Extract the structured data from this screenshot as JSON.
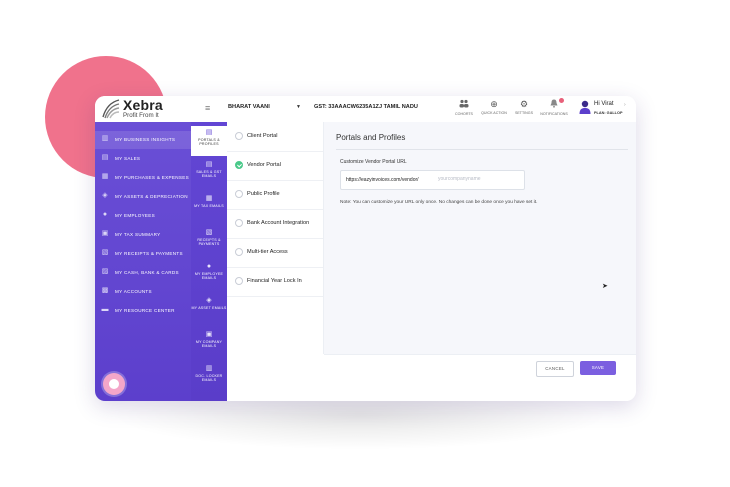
{
  "app": {
    "logo_name": "Xebra",
    "logo_tagline": "Profit From It",
    "company": "BHARAT VAANI",
    "gst": "GST: 33AAACW6235A1ZJ TAMIL NADU"
  },
  "topbar": {
    "icons": [
      {
        "label": "COHORTS",
        "icon": "cohorts-icon"
      },
      {
        "label": "QUICK ACTION",
        "icon": "plus-circle-icon"
      },
      {
        "label": "SETTINGS",
        "icon": "gear-icon"
      },
      {
        "label": "NOTIFICATIONS",
        "icon": "bell-icon"
      }
    ],
    "user": {
      "greeting": "Hi Virat",
      "plan": "PLAN: GALLOP"
    }
  },
  "sidebar": {
    "items": [
      {
        "label": "MY BUSINESS INSIGHTS",
        "icon": "chart-icon"
      },
      {
        "label": "MY SALES",
        "icon": "receipt-icon"
      },
      {
        "label": "MY PURCHASES & EXPENSES",
        "icon": "cart-icon"
      },
      {
        "label": "MY ASSETS & DEPRECIATION",
        "icon": "asset-icon"
      },
      {
        "label": "MY EMPLOYEES",
        "icon": "person-icon"
      },
      {
        "label": "MY TAX SUMMARY",
        "icon": "document-icon"
      },
      {
        "label": "MY RECEIPTS & PAYMENTS",
        "icon": "money-icon"
      },
      {
        "label": "MY CASH, BANK & CARDS",
        "icon": "bank-icon"
      },
      {
        "label": "MY ACCOUNTS",
        "icon": "ledger-icon"
      },
      {
        "label": "MY RESOURCE CENTER",
        "icon": "book-icon"
      }
    ]
  },
  "subnav": {
    "items": [
      {
        "label": "PORTALS & PROFILES",
        "icon": "portal-icon"
      },
      {
        "label": "SALES & GST EMAILS",
        "icon": "mail-icon"
      },
      {
        "label": "MY TAX EMAILS",
        "icon": "tax-mail-icon"
      },
      {
        "label": "RECEIPTS & PAYMENTS",
        "icon": "payment-icon"
      },
      {
        "label": "MY EMPLOYEE EMAILS",
        "icon": "employee-icon"
      },
      {
        "label": "MY ASSET EMAILS",
        "icon": "asset-mail-icon"
      },
      {
        "label": "MY COMPANY EMAILS",
        "icon": "company-icon"
      },
      {
        "label": "DOC. LOCKER EMAILS",
        "icon": "locker-icon"
      }
    ]
  },
  "settings": {
    "items": [
      {
        "label": "Client Portal"
      },
      {
        "label": "Vendor Portal"
      },
      {
        "label": "Public Profile"
      },
      {
        "label": "Bank Account Integration"
      },
      {
        "label": "Multi-tier Access"
      },
      {
        "label": "Financial Year Lock In"
      }
    ]
  },
  "main": {
    "title": "Portals and Profiles",
    "field_label": "Customize Vendor Portal URL",
    "url_prefix": "https://eazyinvoices.com/vendor/",
    "url_placeholder": "yourcompanyname",
    "note": "Note: You can customize your URL only once. No changes can be done once you have set it.",
    "cancel_label": "CANCEL",
    "save_label": "SAVE"
  },
  "colors": {
    "accent": "#6a4fd6",
    "save": "#7b5fe0",
    "check": "#4ac98a",
    "blob": "#f0728c"
  }
}
